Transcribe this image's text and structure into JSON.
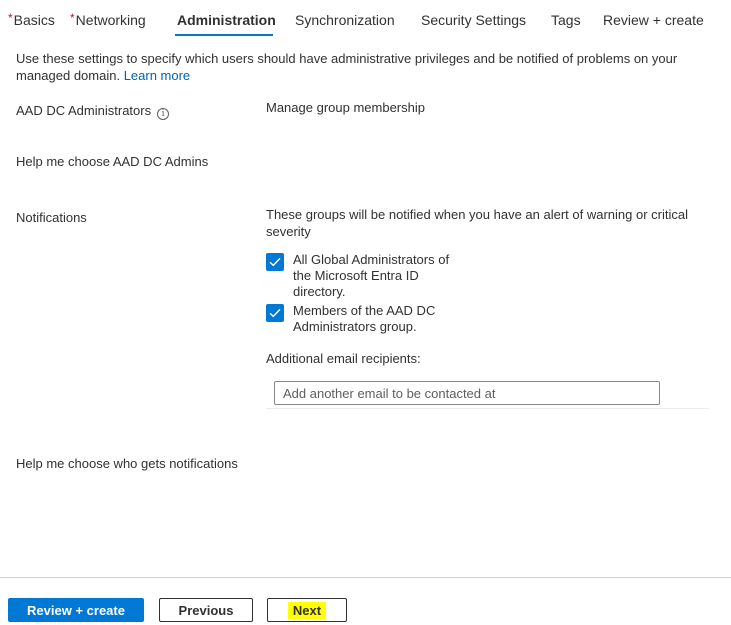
{
  "tabs": [
    {
      "label": "Basics",
      "required": true
    },
    {
      "label": "Networking",
      "required": true
    },
    {
      "label": "Administration",
      "required": false,
      "active": true
    },
    {
      "label": "Synchronization",
      "required": false
    },
    {
      "label": "Security Settings",
      "required": false
    },
    {
      "label": "Tags",
      "required": false
    },
    {
      "label": "Review + create",
      "required": false
    }
  ],
  "required_marker": "*",
  "intro": {
    "text": "Use these settings to specify which users should have administrative privileges and be notified of problems on your managed domain. ",
    "learn_more": "Learn more"
  },
  "admins": {
    "label": "AAD DC Administrators",
    "info_icon": "i",
    "manage_link": "Manage group membership",
    "help_link": "Help me choose AAD DC Admins"
  },
  "notifications": {
    "label": "Notifications",
    "description": "These groups will be notified when you have an alert of warning or critical severity",
    "options": [
      {
        "label": "All Global Administrators of the Microsoft Entra ID directory.",
        "checked": true
      },
      {
        "label": "Members of the AAD DC Administrators group.",
        "checked": true
      }
    ],
    "email_label": "Additional email recipients:",
    "email_placeholder": "Add another email to be contacted at",
    "email_value": "",
    "help_link": "Help me choose who gets notifications"
  },
  "footer": {
    "review_create": "Review + create",
    "previous": "Previous",
    "next": "Next"
  },
  "colors": {
    "accent": "#0078d4",
    "link": "#0063b1",
    "required": "#a4262c",
    "highlight": "#ffff00"
  }
}
